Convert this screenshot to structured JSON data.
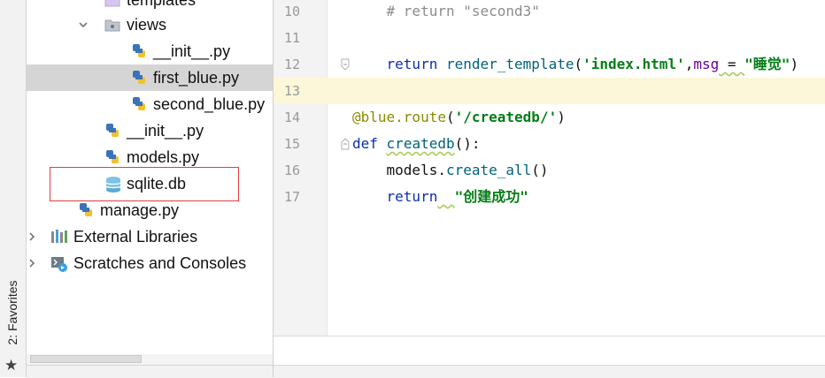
{
  "favorites": {
    "label": "2: Favorites",
    "icon": "star-icon"
  },
  "tree": {
    "items": [
      {
        "label": "templates",
        "icon": "folder-icon",
        "expanded": false
      },
      {
        "label": "views",
        "icon": "package-folder-icon",
        "expanded": true
      },
      {
        "label": "__init__.py",
        "icon": "python-file-icon"
      },
      {
        "label": "first_blue.py",
        "icon": "python-file-icon",
        "selected": true
      },
      {
        "label": "second_blue.py",
        "icon": "python-file-icon"
      },
      {
        "label": "__init__.py",
        "icon": "python-file-icon"
      },
      {
        "label": "models.py",
        "icon": "python-file-icon"
      },
      {
        "label": "sqlite.db",
        "icon": "database-icon",
        "highlighted": true
      },
      {
        "label": "manage.py",
        "icon": "python-file-icon"
      },
      {
        "label": "External Libraries",
        "icon": "libraries-icon",
        "expanded": false
      },
      {
        "label": "Scratches and Consoles",
        "icon": "scratches-icon",
        "expanded": false
      }
    ]
  },
  "editor": {
    "current_line": "13",
    "lines": [
      {
        "num": "10",
        "parts": [
          {
            "t": "    ",
            "c": "plain"
          },
          {
            "t": "# return \"second3\"",
            "c": "cm"
          }
        ]
      },
      {
        "num": "11",
        "parts": []
      },
      {
        "num": "12",
        "parts": [
          {
            "t": "    ",
            "c": "plain"
          },
          {
            "t": "return",
            "c": "kw"
          },
          {
            "t": " ",
            "c": "plain"
          },
          {
            "t": "render_template",
            "c": "fn"
          },
          {
            "t": "(",
            "c": "plain"
          },
          {
            "t": "'index.html'",
            "c": "str"
          },
          {
            "t": ",",
            "c": "plain"
          },
          {
            "t": "msg",
            "c": "param"
          },
          {
            "t": " = ",
            "c": "plain warn"
          },
          {
            "t": "\"睡觉\"",
            "c": "str"
          },
          {
            "t": ")",
            "c": "plain"
          }
        ]
      },
      {
        "num": "13",
        "parts": []
      },
      {
        "num": "14",
        "parts": [
          {
            "t": "@blue.route",
            "c": "deco"
          },
          {
            "t": "(",
            "c": "plain"
          },
          {
            "t": "'/createdb/'",
            "c": "str"
          },
          {
            "t": ")",
            "c": "plain"
          }
        ]
      },
      {
        "num": "15",
        "parts": [
          {
            "t": "def",
            "c": "kw"
          },
          {
            "t": " ",
            "c": "plain"
          },
          {
            "t": "createdb",
            "c": "fn warn"
          },
          {
            "t": "():",
            "c": "plain"
          }
        ]
      },
      {
        "num": "16",
        "parts": [
          {
            "t": "    models.",
            "c": "plain"
          },
          {
            "t": "create_all",
            "c": "fn"
          },
          {
            "t": "()",
            "c": "plain"
          }
        ]
      },
      {
        "num": "17",
        "parts": [
          {
            "t": "    ",
            "c": "plain"
          },
          {
            "t": "return",
            "c": "kw"
          },
          {
            "t": "  ",
            "c": "plain warn"
          },
          {
            "t": "\"创建成功\"",
            "c": "str"
          }
        ]
      }
    ]
  }
}
